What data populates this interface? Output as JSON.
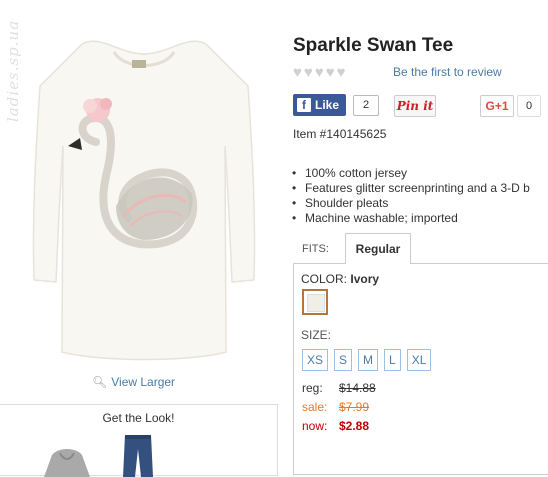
{
  "watermark": "ladies.sp.ua",
  "colors": {
    "link": "#4a7ba6",
    "facebook": "#3b5998",
    "pinterest": "#cb2027",
    "gplus": "#dd4b39",
    "sale": "#e07a2e",
    "now": "#c00000",
    "swatch_border": "#b8753a"
  },
  "image": {
    "view_larger": "View Larger"
  },
  "look": {
    "title": "Get the Look!"
  },
  "product": {
    "title": "Sparkle Swan Tee",
    "rating_stars": 5,
    "review_link": "Be the first to review",
    "item_number": "Item #140145625",
    "features": [
      "100% cotton jersey",
      "Features glitter screenprinting and a 3-D b",
      "Shoulder pleats",
      "Machine washable; imported"
    ]
  },
  "social": {
    "facebook_label": "Like",
    "facebook_count": "2",
    "pinterest_label": "Pin it",
    "gplus_label": "G+1",
    "gplus_count": "0"
  },
  "fits": {
    "label": "FITS:",
    "selected": "Regular"
  },
  "color": {
    "label": "COLOR:",
    "value": "Ivory"
  },
  "size": {
    "label": "SIZE:",
    "options": [
      "XS",
      "S",
      "M",
      "L",
      "XL"
    ]
  },
  "prices": {
    "reg_label": "reg:",
    "reg_value": "$14.88",
    "sale_label": "sale:",
    "sale_value": "$7.99",
    "now_label": "now:",
    "now_value": "$2.88"
  }
}
